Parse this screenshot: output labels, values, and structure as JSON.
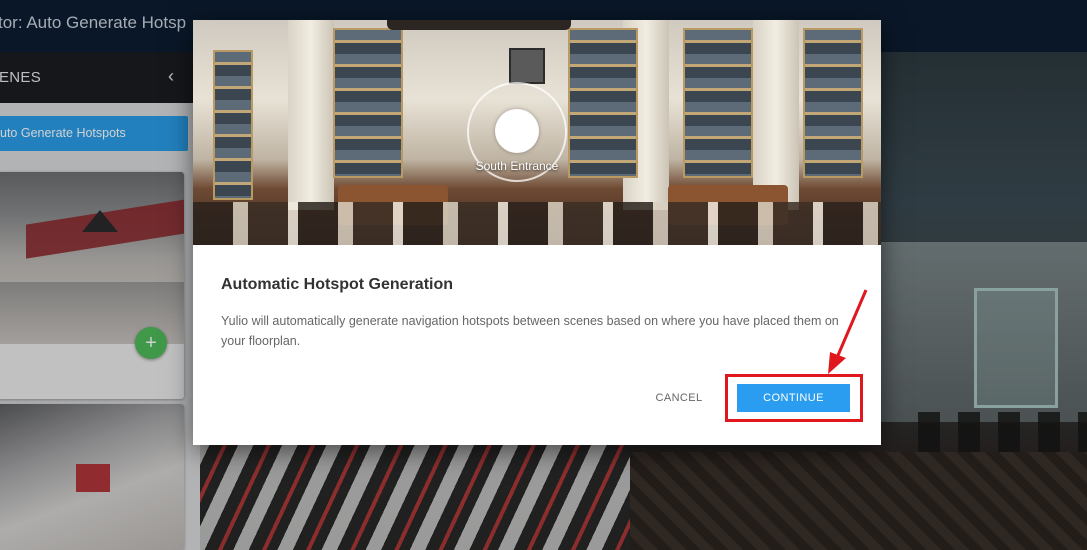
{
  "header": {
    "title": "tor: Auto Generate Hotsp"
  },
  "scenes_panel": {
    "label": "ENES",
    "collapse_icon": "chevron-left-icon",
    "auto_generate_label": "uto Generate Hotspots",
    "add_icon": "plus-icon"
  },
  "modal": {
    "hotspot_label": "South Entrance",
    "title": "Automatic Hotspot Generation",
    "body": "Yulio will automatically generate navigation hotspots between scenes based on where you have placed them on your floorplan.",
    "cancel_label": "CANCEL",
    "continue_label": "CONTINUE"
  },
  "colors": {
    "header_bg": "#0d1d31",
    "accent_blue": "#2b9df0",
    "add_green": "#4dbb5a",
    "annotation_red": "#e0171d"
  }
}
